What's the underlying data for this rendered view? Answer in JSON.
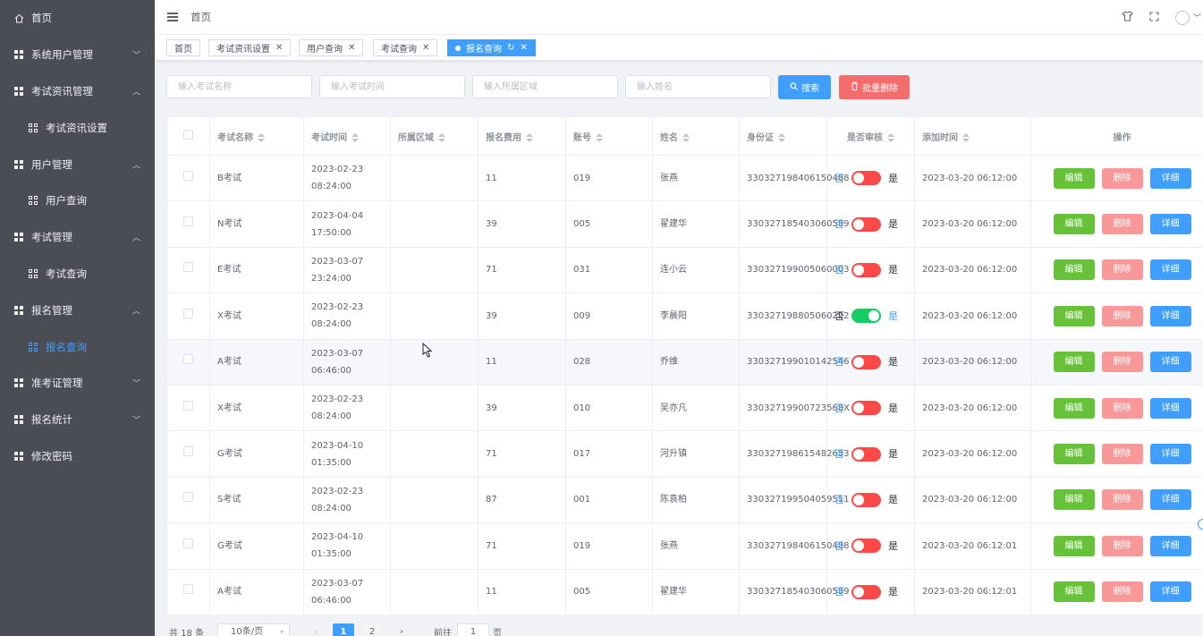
{
  "sidebar": {
    "items": [
      {
        "label": "首页",
        "icon": "home-icon",
        "type": "top"
      },
      {
        "label": "系统用户管理",
        "icon": "grid-icon",
        "type": "group",
        "chevron": "down"
      },
      {
        "label": "考试资讯管理",
        "icon": "grid-icon",
        "type": "group",
        "chevron": "up"
      },
      {
        "label": "考试资讯设置",
        "icon": "apps-icon",
        "type": "sub"
      },
      {
        "label": "用户管理",
        "icon": "grid-icon",
        "type": "group",
        "chevron": "up"
      },
      {
        "label": "用户查询",
        "icon": "apps-icon",
        "type": "sub"
      },
      {
        "label": "考试管理",
        "icon": "grid-icon",
        "type": "group",
        "chevron": "up"
      },
      {
        "label": "考试查询",
        "icon": "apps-icon",
        "type": "sub"
      },
      {
        "label": "报名管理",
        "icon": "grid-icon",
        "type": "group",
        "chevron": "up"
      },
      {
        "label": "报名查询",
        "icon": "apps-icon",
        "type": "sub",
        "active": true
      },
      {
        "label": "准考证管理",
        "icon": "grid-icon",
        "type": "group",
        "chevron": "down"
      },
      {
        "label": "报名统计",
        "icon": "grid-icon",
        "type": "group",
        "chevron": "down"
      },
      {
        "label": "修改密码",
        "icon": "grid-icon",
        "type": "top"
      }
    ]
  },
  "header": {
    "breadcrumb": "首页",
    "icons": [
      "shirt-icon",
      "fullscreen-icon",
      "avatar"
    ]
  },
  "tags": {
    "items": [
      {
        "label": "首页",
        "closable": false
      },
      {
        "label": "考试资讯设置",
        "closable": true
      },
      {
        "label": "用户查询",
        "closable": true
      },
      {
        "label": "考试查询",
        "closable": true
      },
      {
        "label": "报名查询",
        "closable": true,
        "active": true
      }
    ],
    "close_glyph": "✕",
    "refresh_glyph": "↻"
  },
  "search": {
    "exam_name_placeholder": "输入考试名称",
    "exam_time_placeholder": "输入考试时间",
    "region_placeholder": "输入所属区域",
    "name_placeholder": "输入姓名",
    "search_label": "搜索",
    "batch_delete_label": "批量删除"
  },
  "table": {
    "headers": [
      "考试名称",
      "考试时间",
      "所属区域",
      "报名费用",
      "账号",
      "姓名",
      "身份证",
      "是否审核",
      "添加时间",
      "操作"
    ],
    "switch_no": "否",
    "switch_yes": "是",
    "edit_label": "编辑",
    "delete_label": "删除",
    "detail_label": "详细",
    "rows": [
      {
        "exam": "B考试",
        "time": "2023-02-23 08:24:00",
        "region": "",
        "fee": "11",
        "account": "019",
        "name": "张燕",
        "id": "330327198406150488",
        "approved": false,
        "added": "2023-03-20 06:12:00"
      },
      {
        "exam": "N考试",
        "time": "2023-04-04 17:50:00",
        "region": "",
        "fee": "39",
        "account": "005",
        "name": "翟建华",
        "id": "330327185403060589",
        "approved": false,
        "added": "2023-03-20 06:12:00"
      },
      {
        "exam": "E考试",
        "time": "2023-03-07 23:24:00",
        "region": "",
        "fee": "71",
        "account": "031",
        "name": "连小云",
        "id": "330327199005060003",
        "approved": false,
        "added": "2023-03-20 06:12:00"
      },
      {
        "exam": "X考试",
        "time": "2023-02-23 08:24:00",
        "region": "",
        "fee": "39",
        "account": "009",
        "name": "李晨阳",
        "id": "330327198805060222",
        "approved": true,
        "added": "2023-03-20 06:12:00"
      },
      {
        "exam": "A考试",
        "time": "2023-03-07 06:46:00",
        "region": "",
        "fee": "11",
        "account": "028",
        "name": "乔维",
        "id": "330327199010142546",
        "approved": false,
        "added": "2023-03-20 06:12:00"
      },
      {
        "exam": "X考试",
        "time": "2023-02-23 08:24:00",
        "region": "",
        "fee": "39",
        "account": "010",
        "name": "吴亦凡",
        "id": "33032719900723568X",
        "approved": false,
        "added": "2023-03-20 06:12:00"
      },
      {
        "exam": "G考试",
        "time": "2023-04-10 01:35:00",
        "region": "",
        "fee": "71",
        "account": "017",
        "name": "河升镇",
        "id": "330327198615482633",
        "approved": false,
        "added": "2023-03-20 06:12:00"
      },
      {
        "exam": "S考试",
        "time": "2023-02-23 08:24:00",
        "region": "",
        "fee": "87",
        "account": "001",
        "name": "陈袁柏",
        "id": "330327199504059511",
        "approved": false,
        "added": "2023-03-20 06:12:00"
      },
      {
        "exam": "G考试",
        "time": "2023-04-10 01:35:00",
        "region": "",
        "fee": "71",
        "account": "019",
        "name": "张燕",
        "id": "330327198406150488",
        "approved": false,
        "added": "2023-03-20 06:12:01"
      },
      {
        "exam": "A考试",
        "time": "2023-03-07 06:46:00",
        "region": "",
        "fee": "11",
        "account": "005",
        "name": "翟建华",
        "id": "330327185403060589",
        "approved": false,
        "added": "2023-03-20 06:12:01"
      }
    ]
  },
  "pagination": {
    "total": "共 18 条",
    "page_size": "10条/页",
    "prev": "‹",
    "pages": [
      "1",
      "2"
    ],
    "current": "1",
    "next": "›",
    "goto_label": "前往",
    "goto_value": "1",
    "goto_unit": "页"
  },
  "colors": {
    "sidebar_bg": "#4a4d54",
    "accent": "#409eff",
    "switch_on": "#13ce66",
    "switch_off": "#ff4949",
    "edit": "#67c23a",
    "delete": "#f89898"
  }
}
